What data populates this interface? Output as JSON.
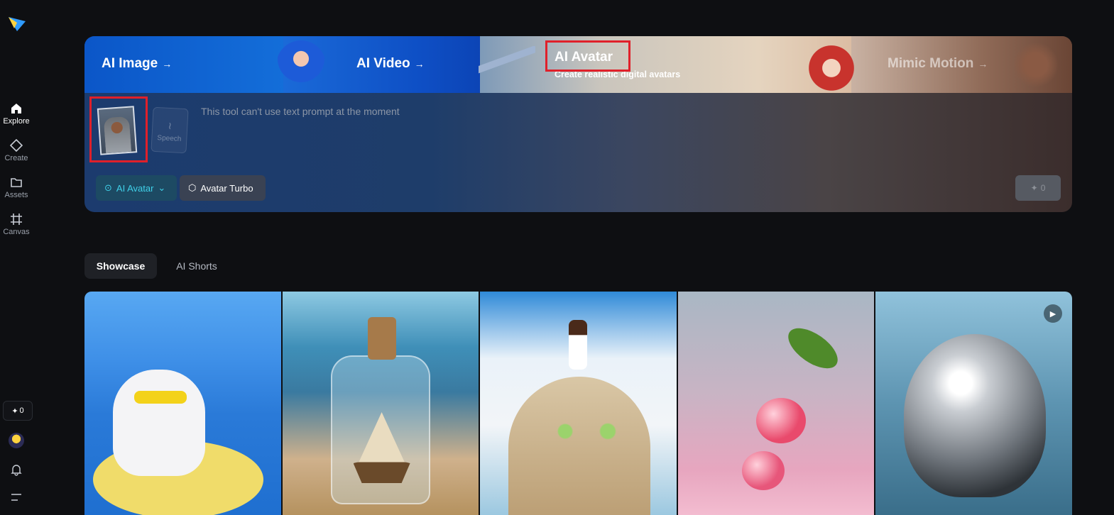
{
  "sidebar": {
    "items": [
      {
        "label": "Explore",
        "icon": "home-icon",
        "active": true
      },
      {
        "label": "Create",
        "icon": "diamond-icon",
        "active": false
      },
      {
        "label": "Assets",
        "icon": "folder-icon",
        "active": false
      },
      {
        "label": "Canvas",
        "icon": "crop-icon",
        "active": false
      }
    ],
    "credits": "0",
    "credits_icon": "sparkle-icon"
  },
  "hero": {
    "tabs": [
      {
        "label": "AI Image",
        "arrow": "→"
      },
      {
        "label": "AI Video",
        "arrow": "→"
      },
      {
        "label": "AI Avatar",
        "subtitle": "Create realistic digital avatars"
      },
      {
        "label": "Mimic Motion",
        "arrow": "→"
      }
    ],
    "speech_label": "Speech",
    "prompt_placeholder": "This tool can't use text prompt at the moment",
    "model_chip": "AI Avatar",
    "turbo_chip": "Avatar Turbo",
    "generate_cost": "0"
  },
  "showcase": {
    "tabs": [
      "Showcase",
      "AI Shorts"
    ],
    "active_tab": "Showcase"
  },
  "colors": {
    "accent": "#3fd0e8",
    "highlight": "#e0202a",
    "background": "#0e0f12"
  }
}
